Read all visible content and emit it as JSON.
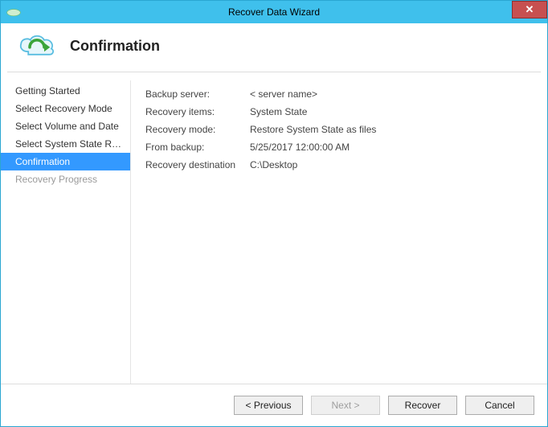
{
  "window": {
    "title": "Recover Data Wizard"
  },
  "header": {
    "page_title": "Confirmation"
  },
  "sidebar": {
    "steps": [
      {
        "label": "Getting Started",
        "selected": false,
        "disabled": false
      },
      {
        "label": "Select Recovery Mode",
        "selected": false,
        "disabled": false
      },
      {
        "label": "Select Volume and Date",
        "selected": false,
        "disabled": false
      },
      {
        "label": "Select System State Reco...",
        "selected": false,
        "disabled": false
      },
      {
        "label": "Confirmation",
        "selected": true,
        "disabled": false
      },
      {
        "label": "Recovery Progress",
        "selected": false,
        "disabled": true
      }
    ]
  },
  "details": {
    "rows": [
      {
        "label": "Backup server:",
        "value": "< server name>"
      },
      {
        "label": "Recovery items:",
        "value": "System State"
      },
      {
        "label": "Recovery mode:",
        "value": "Restore System State as files"
      },
      {
        "label": "From backup:",
        "value": "5/25/2017 12:00:00 AM"
      },
      {
        "label": "Recovery destination",
        "value": "C:\\Desktop"
      }
    ]
  },
  "footer": {
    "previous": "< Previous",
    "next": "Next >",
    "recover": "Recover",
    "cancel": "Cancel"
  }
}
